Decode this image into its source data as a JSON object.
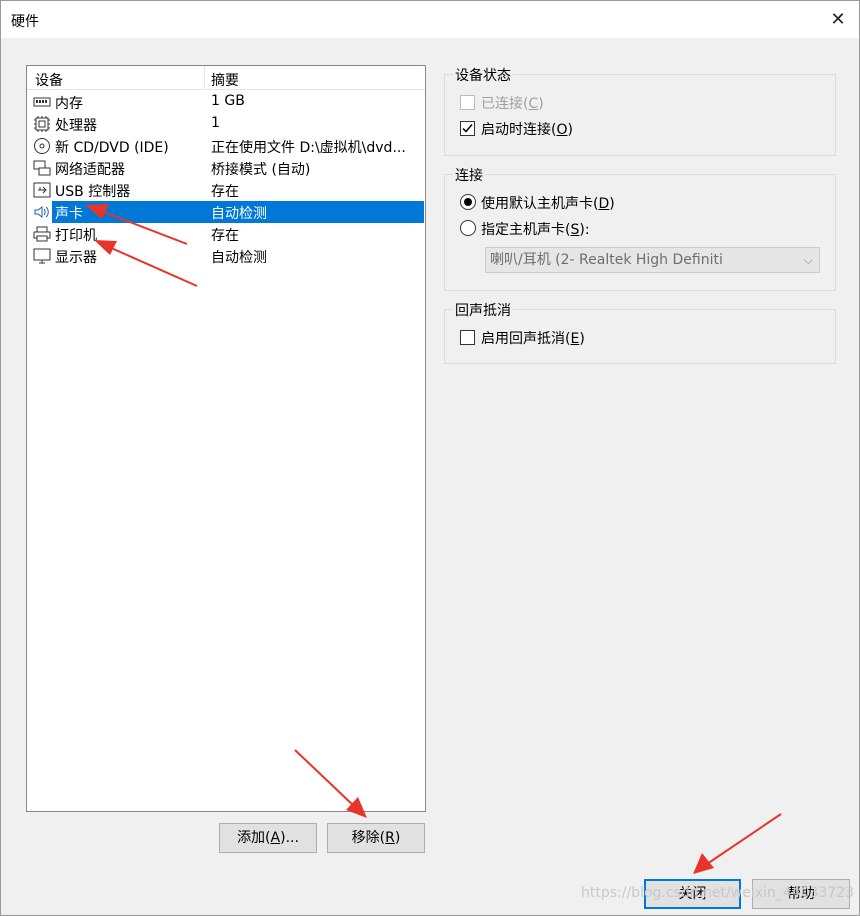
{
  "window": {
    "title": "硬件",
    "close_glyph": "✕"
  },
  "list": {
    "headers": [
      "设备",
      "摘要"
    ],
    "rows": [
      {
        "icon": "memory-icon",
        "name": "内存",
        "summary": "1 GB"
      },
      {
        "icon": "cpu-icon",
        "name": "处理器",
        "summary": "1"
      },
      {
        "icon": "cd-dvd-icon",
        "name": "新 CD/DVD (IDE)",
        "summary": "正在使用文件 D:\\虚拟机\\dvd..."
      },
      {
        "icon": "network-adapter-icon",
        "name": "网络适配器",
        "summary": "桥接模式 (自动)"
      },
      {
        "icon": "usb-controller-icon",
        "name": "USB 控制器",
        "summary": "存在"
      },
      {
        "icon": "speaker-icon",
        "name": "声卡",
        "summary": "自动检测",
        "selected": true
      },
      {
        "icon": "printer-icon",
        "name": "打印机",
        "summary": "存在"
      },
      {
        "icon": "monitor-icon",
        "name": "显示器",
        "summary": "自动检测"
      }
    ]
  },
  "buttons": {
    "add": {
      "text": "添加(",
      "key": "A",
      "tail": ")..."
    },
    "remove": {
      "text": "移除(",
      "key": "R",
      "tail": ")"
    },
    "close": "关闭",
    "help": "帮助"
  },
  "device_status": {
    "title": "设备状态",
    "connected": {
      "text": "已连接(",
      "key": "C",
      "tail": ")",
      "checked": false,
      "disabled": true
    },
    "connect_at_power_on": {
      "text": "启动时连接(",
      "key": "O",
      "tail": ")",
      "checked": true
    }
  },
  "connection": {
    "title": "连接",
    "use_default": {
      "text": "使用默认主机声卡(",
      "key": "D",
      "tail": ")",
      "selected": true
    },
    "specify": {
      "text": "指定主机声卡(",
      "key": "S",
      "tail": "):",
      "selected": false
    },
    "host_card_value": "喇叭/耳机 (2- Realtek High Definiti"
  },
  "echo_cancel": {
    "title": "回声抵消",
    "enable": {
      "text": "启用回声抵消(",
      "key": "E",
      "tail": ")",
      "checked": false
    }
  },
  "watermark": "https://blog.csdn.net/weixin_44033723",
  "colors": {
    "selection": "#0078d7",
    "arrow": "#e8342a"
  }
}
